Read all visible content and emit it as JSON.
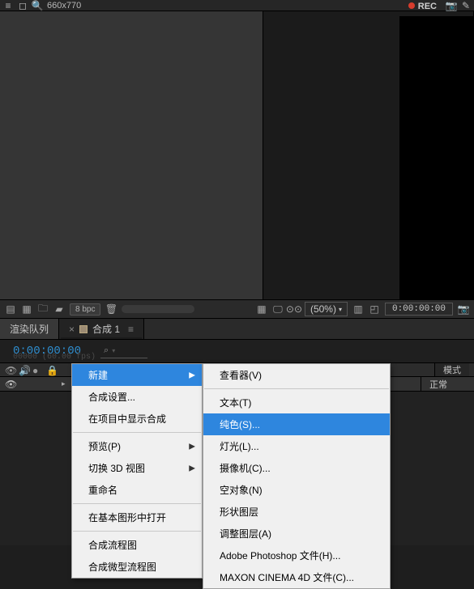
{
  "topbar": {
    "search_value": "660x770",
    "rec_label": "REC"
  },
  "footer_bar": {
    "bpc_label": "8 bpc",
    "mag_pct": "(50%)",
    "timecode": "0:00:00:00"
  },
  "timeline": {
    "tab_render_queue": "渲染队列",
    "tab_comp": "合成 1",
    "timecode": "0:00:00:00",
    "timecode_sub": "00000 (60.00 fps)",
    "mode_header": "模式",
    "mode_value": "正常",
    "search_placeholder": ""
  },
  "context_menu1": {
    "new": "新建",
    "comp_settings": "合成设置...",
    "reveal_in_project": "在项目中显示合成",
    "preview": "预览(P)",
    "switch_3d": "切换 3D 视图",
    "rename": "重命名",
    "open_egp": "在基本图形中打开",
    "flowchart": "合成流程图",
    "mini_flowchart": "合成微型流程图"
  },
  "context_menu2": {
    "viewer": "查看器(V)",
    "text": "文本(T)",
    "solid": "纯色(S)...",
    "light": "灯光(L)...",
    "camera": "摄像机(C)...",
    "null": "空对象(N)",
    "shape": "形状图层",
    "adjustment": "调整图层(A)",
    "ps": "Adobe Photoshop 文件(H)...",
    "c4d": "MAXON CINEMA 4D 文件(C)..."
  }
}
